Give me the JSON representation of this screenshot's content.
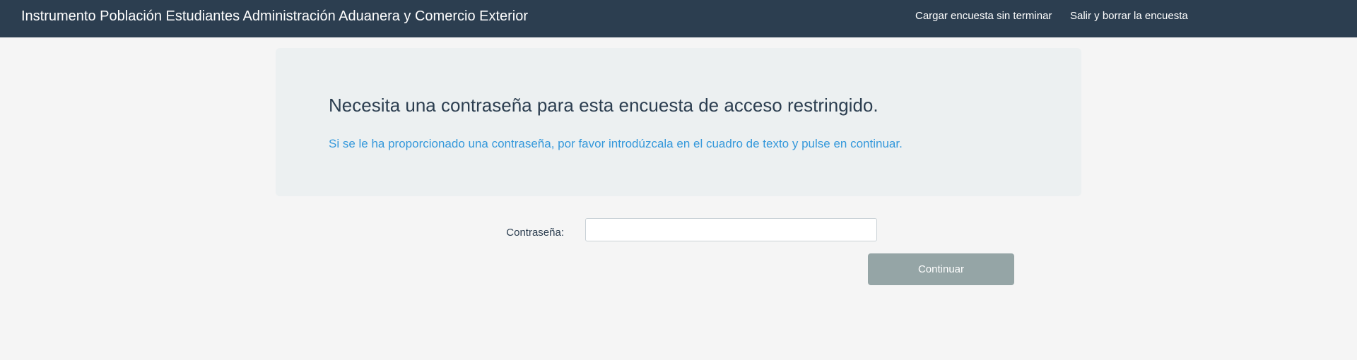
{
  "header": {
    "title": "Instrumento Población Estudiantes Administración Aduanera y Comercio Exterior",
    "load_link": "Cargar encuesta sin terminar",
    "exit_link": "Salir y borrar la encuesta"
  },
  "alert": {
    "title": "Necesita una contraseña para esta encuesta de acceso restringido.",
    "text": "Si se le ha proporcionado una contraseña, por favor introdúzcala en el cuadro de texto y pulse en continuar."
  },
  "form": {
    "password_label": "Contraseña:",
    "password_value": "",
    "continue_label": "Continuar"
  },
  "colors": {
    "navbar": "#2c3e50",
    "alert_bg": "#ecf0f1",
    "link_text": "#3498db",
    "button": "#95a5a6"
  }
}
